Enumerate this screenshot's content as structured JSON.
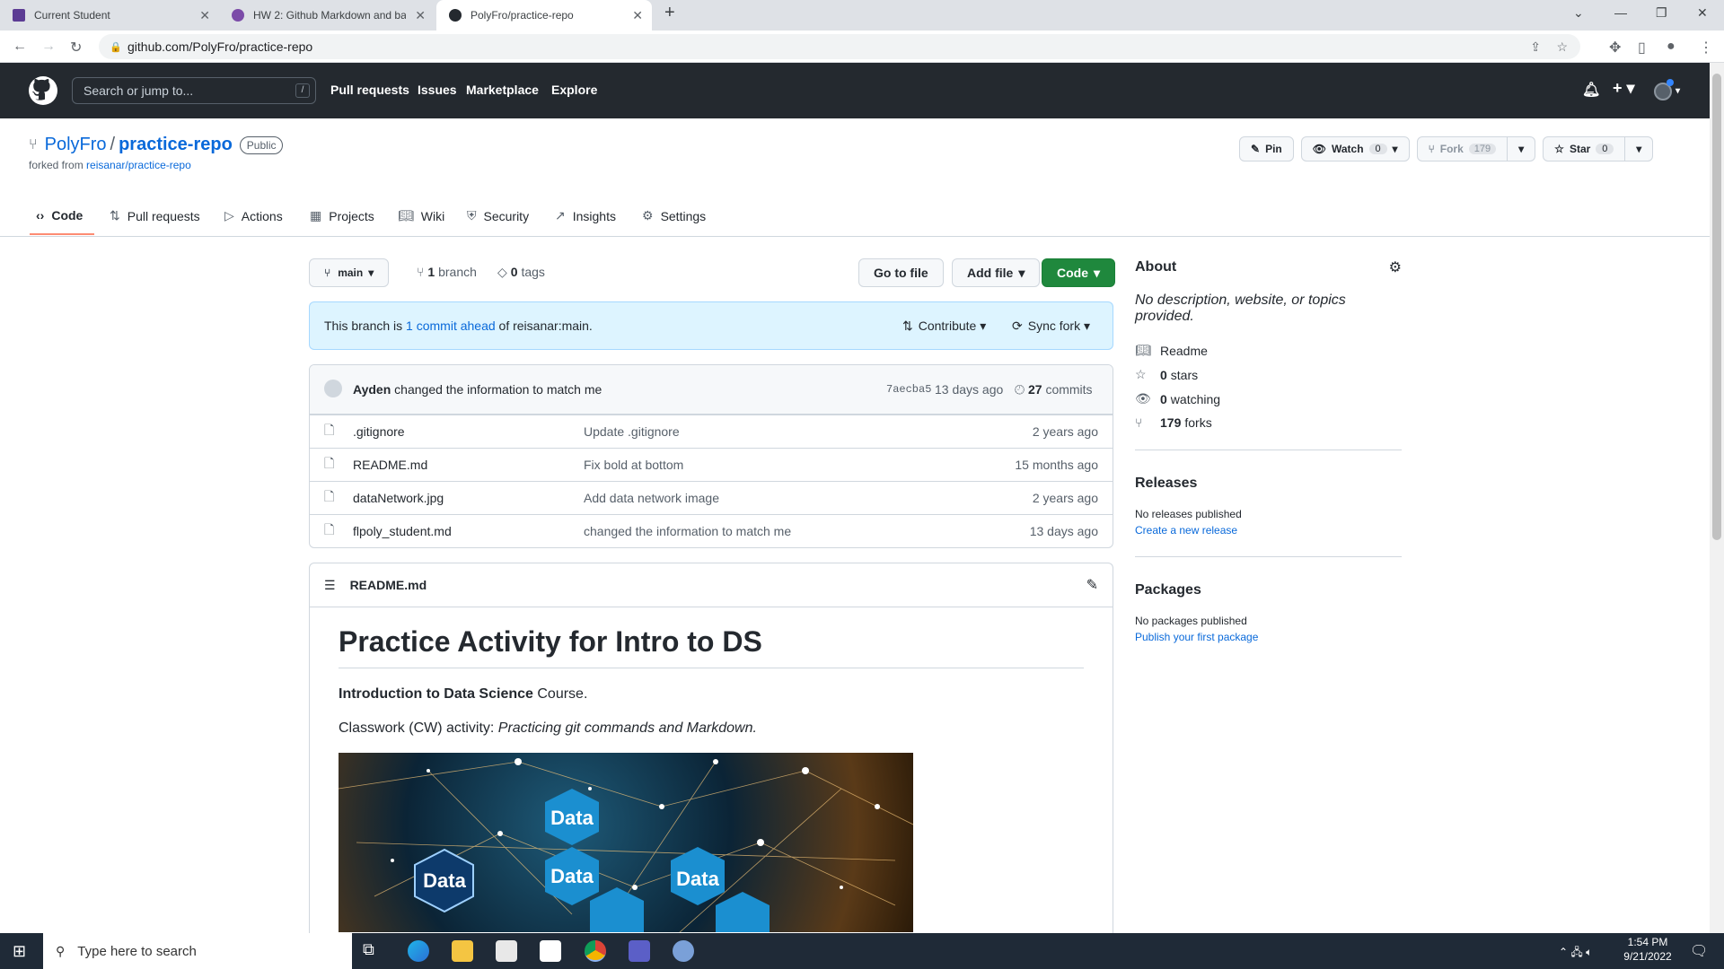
{
  "browser": {
    "tabs": [
      {
        "title": "Current Student",
        "color": "#5c3c94"
      },
      {
        "title": "HW 2: Github Markdown and ba",
        "color": "#7b4ba8"
      },
      {
        "title": "PolyFro/practice-repo",
        "color": "#24292f"
      }
    ],
    "url": "github.com/PolyFro/practice-repo"
  },
  "header": {
    "search_placeholder": "Search or jump to...",
    "slash_key": "/",
    "nav": [
      "Pull requests",
      "Issues",
      "Marketplace",
      "Explore"
    ]
  },
  "repo": {
    "owner": "PolyFro",
    "separator": "/",
    "name": "practice-repo",
    "visibility": "Public",
    "forked_from_label": "forked from",
    "forked_from": "reisanar/practice-repo",
    "pin_label": "Pin",
    "watch_label": "Watch",
    "watch_count": "0",
    "fork_label": "Fork",
    "fork_count": "179",
    "star_label": "Star",
    "star_count": "0"
  },
  "tabs": [
    {
      "label": "Code",
      "icon": "code-icon"
    },
    {
      "label": "Pull requests",
      "icon": "pull-request-icon"
    },
    {
      "label": "Actions",
      "icon": "play-icon"
    },
    {
      "label": "Projects",
      "icon": "table-icon"
    },
    {
      "label": "Wiki",
      "icon": "book-icon"
    },
    {
      "label": "Security",
      "icon": "shield-icon"
    },
    {
      "label": "Insights",
      "icon": "graph-icon"
    },
    {
      "label": "Settings",
      "icon": "gear-icon"
    }
  ],
  "toolbar": {
    "branch": "main",
    "branches_count": "1",
    "branches_label": "branch",
    "tags_count": "0",
    "tags_label": "tags",
    "go_to_file": "Go to file",
    "add_file": "Add file",
    "code": "Code"
  },
  "flash": {
    "prefix": "This branch is",
    "link": "1 commit ahead",
    "suffix": "of reisanar:main.",
    "contribute": "Contribute",
    "sync": "Sync fork"
  },
  "commit": {
    "author": "Ayden",
    "message": "changed the information to match me",
    "sha": "7aecba5",
    "age": "13 days ago",
    "count": "27",
    "count_label": "commits"
  },
  "files": [
    {
      "name": ".gitignore",
      "message": "Update .gitignore",
      "age": "2 years ago"
    },
    {
      "name": "README.md",
      "message": "Fix bold at bottom",
      "age": "15 months ago"
    },
    {
      "name": "dataNetwork.jpg",
      "message": "Add data network image",
      "age": "2 years ago"
    },
    {
      "name": "flpoly_student.md",
      "message": "changed the information to match me",
      "age": "13 days ago"
    }
  ],
  "readme": {
    "filename": "README.md",
    "title": "Practice Activity for Intro to DS",
    "line1_bold": "Introduction to Data Science",
    "line1_rest": " Course.",
    "line2_prefix": "Classwork (CW) activity: ",
    "line2_italic": "Practicing git commands and Markdown.",
    "image_word": "Data"
  },
  "about": {
    "title": "About",
    "description": "No description, website, or topics provided.",
    "readme": "Readme",
    "stars_count": "0",
    "stars_label": "stars",
    "watching_count": "0",
    "watching_label": "watching",
    "forks_count": "179",
    "forks_label": "forks"
  },
  "releases": {
    "title": "Releases",
    "none": "No releases published",
    "create": "Create a new release"
  },
  "packages": {
    "title": "Packages",
    "none": "No packages published",
    "publish": "Publish your first package"
  },
  "taskbar": {
    "search": "Type here to search",
    "time": "1:54 PM",
    "date": "9/21/2022"
  }
}
